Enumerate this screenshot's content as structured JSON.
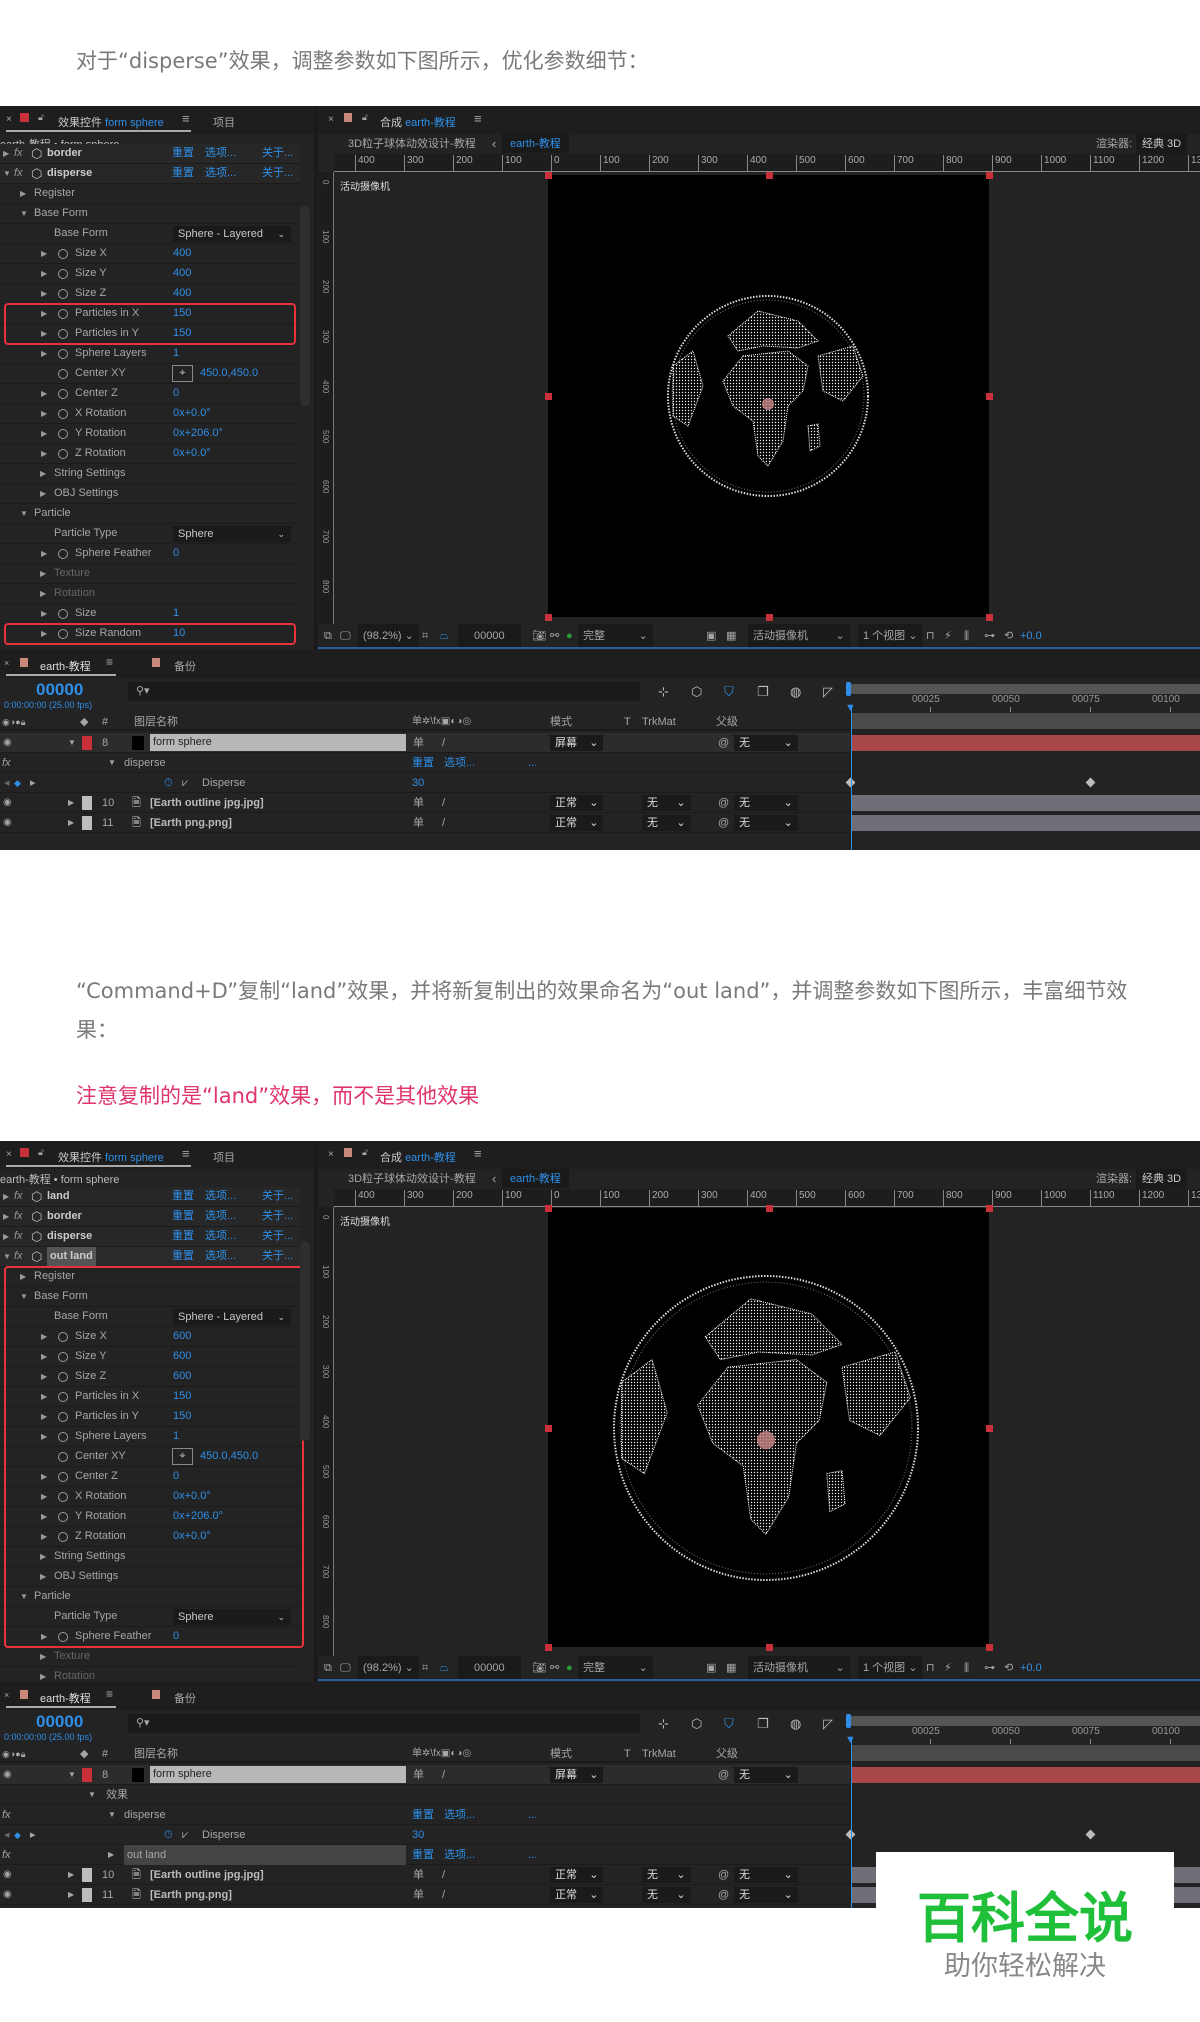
{
  "texts": {
    "intro1": "对于“disperse”效果，调整参数如下图所示，优化参数细节：",
    "intro2": "“Command+D”复制“land”效果，并将新复制出的效果命名为“out land”，并调整参数如下图所示，丰富细节效果：",
    "warning": "注意复制的是“land”效果，而不是其他效果"
  },
  "colors": {
    "accent_blue": "#2f8fe8",
    "highlight_red": "#e8323c",
    "layer_red": "#a84848",
    "warning_pink": "#e0356a",
    "watermark_green": "#1fbf3a"
  },
  "watermark": {
    "title": "百科全说",
    "subtitle": "助你轻松解决"
  },
  "screens": [
    {
      "effects_panel": {
        "tab_prefix": "效果控件",
        "tab_layer": "form sphere",
        "project_tab": "项目",
        "breadcrumb": "earth-教程 • form sphere",
        "effects": [
          {
            "name": "border",
            "expanded": false,
            "partial": true,
            "reset": "重置",
            "options": "选项...",
            "about": "关于..."
          },
          {
            "name": "disperse",
            "expanded": true,
            "reset": "重置",
            "options": "选项...",
            "about": "关于..."
          }
        ],
        "rows": [
          {
            "kind": "group",
            "level": 1,
            "label": "Register",
            "open": false
          },
          {
            "kind": "group",
            "level": 1,
            "label": "Base Form",
            "open": true
          },
          {
            "kind": "dropdown",
            "label": "Base Form",
            "value": "Sphere - Layered"
          },
          {
            "kind": "prop",
            "label": "Size X",
            "value": "400"
          },
          {
            "kind": "prop",
            "label": "Size Y",
            "value": "400"
          },
          {
            "kind": "prop",
            "label": "Size Z",
            "value": "400"
          },
          {
            "kind": "prop",
            "label": "Particles in X",
            "value": "150",
            "highlighted": true
          },
          {
            "kind": "prop",
            "label": "Particles in Y",
            "value": "150",
            "highlighted": true
          },
          {
            "kind": "prop",
            "label": "Sphere Layers",
            "value": "1"
          },
          {
            "kind": "point",
            "label": "Center XY",
            "value": "450.0,450.0"
          },
          {
            "kind": "prop",
            "label": "Center Z",
            "value": "0"
          },
          {
            "kind": "prop",
            "label": "X Rotation",
            "value": "0x+0.0°"
          },
          {
            "kind": "prop",
            "label": "Y Rotation",
            "value": "0x+206.0°"
          },
          {
            "kind": "prop",
            "label": "Z Rotation",
            "value": "0x+0.0°"
          },
          {
            "kind": "group",
            "level": 2,
            "label": "String Settings",
            "open": false
          },
          {
            "kind": "group",
            "level": 2,
            "label": "OBJ Settings",
            "open": false
          },
          {
            "kind": "group",
            "level": 1,
            "label": "Particle",
            "open": true
          },
          {
            "kind": "dropdown",
            "label": "Particle Type",
            "value": "Sphere"
          },
          {
            "kind": "prop",
            "label": "Sphere Feather",
            "value": "0"
          },
          {
            "kind": "group",
            "level": 2,
            "label": "Texture",
            "open": false,
            "dim": true
          },
          {
            "kind": "group",
            "level": 2,
            "label": "Rotation",
            "open": false,
            "dim": true
          },
          {
            "kind": "prop",
            "label": "Size",
            "value": "1"
          },
          {
            "kind": "prop",
            "label": "Size Random",
            "value": "10",
            "highlighted": true
          }
        ]
      },
      "comp_panel": {
        "tab_prefix": "合成",
        "comp_name": "earth-教程",
        "parent_comp": "3D粒子球体动效设计-教程",
        "current_comp": "earth-教程",
        "renderer_label": "渲染器:",
        "renderer": "经典 3D",
        "ruler": [
          "400",
          "300",
          "200",
          "100",
          "0",
          "100",
          "200",
          "300",
          "400",
          "500",
          "600",
          "700",
          "800",
          "900",
          "1000",
          "1100",
          "1200",
          "13"
        ],
        "camera_label": "活动摄像机",
        "toolbar": {
          "zoom": "(98.2%)",
          "timecode": "00000",
          "quality": "完整",
          "view": "活动摄像机",
          "views": "1 个视图",
          "exposure": "+0.0"
        }
      },
      "timeline": {
        "tab": "earth-教程",
        "tab2": "备份",
        "timecode": "00000",
        "fps": "0:00:00:00 (25.00 fps)",
        "headers": {
          "num": "#",
          "name": "图层名称",
          "mode": "模式",
          "t": "T",
          "trkmat": "TrkMat",
          "parent": "父级"
        },
        "ruler": [
          "00025",
          "00050",
          "00075",
          "00100"
        ],
        "rows": [
          {
            "kind": "layer",
            "num": "8",
            "name": "form sphere",
            "label_color": "#c8303a",
            "mode": "屏幕",
            "parent": "无",
            "selected": true,
            "bar": "#a84848"
          },
          {
            "kind": "effect",
            "name": "disperse",
            "reset": "重置",
            "options": "选项...",
            "more": "..."
          },
          {
            "kind": "prop",
            "name": "Disperse",
            "value": "30",
            "keyframes": [
              0,
              75
            ]
          },
          {
            "kind": "layer",
            "num": "10",
            "name": "[Earth outline jpg.jpg]",
            "label_color": "#bdbdbd",
            "mode": "正常",
            "trkmat": "无",
            "parent": "无",
            "bar": "#6f6f78"
          },
          {
            "kind": "layer",
            "num": "11",
            "name": "[Earth png.png]",
            "label_color": "#bdbdbd",
            "mode": "正常",
            "trkmat": "无",
            "parent": "无",
            "bar": "#6f6f78"
          }
        ]
      }
    },
    {
      "effects_panel": {
        "tab_prefix": "效果控件",
        "tab_layer": "form sphere",
        "project_tab": "项目",
        "breadcrumb": "earth-教程 • form sphere",
        "effects": [
          {
            "name": "land",
            "expanded": false,
            "reset": "重置",
            "options": "选项...",
            "about": "关于..."
          },
          {
            "name": "border",
            "expanded": false,
            "reset": "重置",
            "options": "选项...",
            "about": "关于..."
          },
          {
            "name": "disperse",
            "expanded": false,
            "reset": "重置",
            "options": "选项...",
            "about": "关于..."
          },
          {
            "name": "out land",
            "expanded": true,
            "selected": true,
            "reset": "重置",
            "options": "选项...",
            "about": "关于..."
          }
        ],
        "rows": [
          {
            "kind": "group",
            "level": 1,
            "label": "Register",
            "open": false,
            "highlighted": true
          },
          {
            "kind": "group",
            "level": 1,
            "label": "Base Form",
            "open": true,
            "highlighted": true
          },
          {
            "kind": "dropdown",
            "label": "Base Form",
            "value": "Sphere - Layered",
            "highlighted": true
          },
          {
            "kind": "prop",
            "label": "Size X",
            "value": "600",
            "highlighted": true
          },
          {
            "kind": "prop",
            "label": "Size Y",
            "value": "600",
            "highlighted": true
          },
          {
            "kind": "prop",
            "label": "Size Z",
            "value": "600",
            "highlighted": true
          },
          {
            "kind": "prop",
            "label": "Particles in X",
            "value": "150",
            "highlighted": true
          },
          {
            "kind": "prop",
            "label": "Particles in Y",
            "value": "150",
            "highlighted": true
          },
          {
            "kind": "prop",
            "label": "Sphere Layers",
            "value": "1",
            "highlighted": true
          },
          {
            "kind": "point",
            "label": "Center XY",
            "value": "450.0,450.0",
            "highlighted": true
          },
          {
            "kind": "prop",
            "label": "Center Z",
            "value": "0",
            "highlighted": true
          },
          {
            "kind": "prop",
            "label": "X Rotation",
            "value": "0x+0.0°",
            "highlighted": true
          },
          {
            "kind": "prop",
            "label": "Y Rotation",
            "value": "0x+206.0°",
            "highlighted": true
          },
          {
            "kind": "prop",
            "label": "Z Rotation",
            "value": "0x+0.0°",
            "highlighted": true
          },
          {
            "kind": "group",
            "level": 2,
            "label": "String Settings",
            "open": false,
            "highlighted": true
          },
          {
            "kind": "group",
            "level": 2,
            "label": "OBJ Settings",
            "open": false,
            "highlighted": true
          },
          {
            "kind": "group",
            "level": 1,
            "label": "Particle",
            "open": true,
            "highlighted": true
          },
          {
            "kind": "dropdown",
            "label": "Particle Type",
            "value": "Sphere",
            "highlighted": true
          },
          {
            "kind": "prop",
            "label": "Sphere Feather",
            "value": "0",
            "highlighted": true
          },
          {
            "kind": "group",
            "level": 2,
            "label": "Texture",
            "open": false,
            "dim": true
          },
          {
            "kind": "group",
            "level": 2,
            "label": "Rotation",
            "open": false,
            "dim": true
          }
        ]
      },
      "comp_panel": {
        "tab_prefix": "合成",
        "comp_name": "earth-教程",
        "parent_comp": "3D粒子球体动效设计-教程",
        "current_comp": "earth-教程",
        "renderer_label": "渲染器:",
        "renderer": "经典 3D",
        "ruler": [
          "400",
          "300",
          "200",
          "100",
          "0",
          "100",
          "200",
          "300",
          "400",
          "500",
          "600",
          "700",
          "800",
          "900",
          "1000",
          "1100",
          "1200",
          "13"
        ],
        "camera_label": "活动摄像机",
        "toolbar": {
          "zoom": "(98.2%)",
          "timecode": "00000",
          "quality": "完整",
          "view": "活动摄像机",
          "views": "1 个视图",
          "exposure": "+0.0"
        }
      },
      "timeline": {
        "tab": "earth-教程",
        "tab2": "备份",
        "timecode": "00000",
        "fps": "0:00:00:00 (25.00 fps)",
        "headers": {
          "num": "#",
          "name": "图层名称",
          "mode": "模式",
          "t": "T",
          "trkmat": "TrkMat",
          "parent": "父级"
        },
        "ruler": [
          "00025",
          "00050",
          "00075",
          "00100"
        ],
        "rows": [
          {
            "kind": "layer",
            "num": "8",
            "name": "form sphere",
            "label_color": "#c8303a",
            "mode": "屏幕",
            "parent": "无",
            "selected": true,
            "bar": "#a84848"
          },
          {
            "kind": "group",
            "name": "效果"
          },
          {
            "kind": "effect",
            "name": "disperse",
            "reset": "重置",
            "options": "选项...",
            "more": "..."
          },
          {
            "kind": "prop",
            "name": "Disperse",
            "value": "30",
            "keyframes": [
              0,
              75
            ]
          },
          {
            "kind": "effect",
            "name": "out land",
            "collapsed": true,
            "selected": true,
            "reset": "重置",
            "options": "选项...",
            "more": "..."
          },
          {
            "kind": "layer",
            "num": "10",
            "name": "[Earth outline jpg.jpg]",
            "label_color": "#bdbdbd",
            "mode": "正常",
            "trkmat": "无",
            "parent": "无",
            "bar": "#6f6f78"
          },
          {
            "kind": "layer",
            "num": "11",
            "name": "[Earth png.png]",
            "label_color": "#bdbdbd",
            "mode": "正常",
            "trkmat": "无",
            "parent": "无",
            "bar": "#6f6f78"
          }
        ]
      }
    }
  ]
}
